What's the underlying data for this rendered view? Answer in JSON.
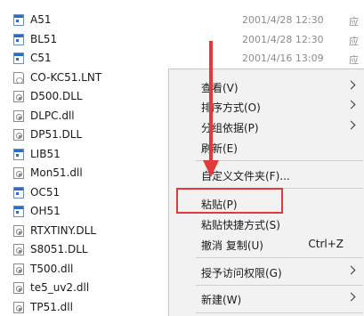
{
  "files": [
    {
      "name": "A51",
      "date": "2001/4/28 12:30",
      "type": "应",
      "icon": "app"
    },
    {
      "name": "BL51",
      "date": "2001/4/28 12:30",
      "type": "应",
      "icon": "app"
    },
    {
      "name": "C51",
      "date": "2001/4/16 13:09",
      "type": "应",
      "icon": "app"
    },
    {
      "name": "CO-KC51.LNT",
      "date": "",
      "type": "",
      "icon": "doc"
    },
    {
      "name": "D500.DLL",
      "date": "",
      "type": "",
      "icon": "dll"
    },
    {
      "name": "DLPC.dll",
      "date": "",
      "type": "",
      "icon": "dll"
    },
    {
      "name": "DP51.DLL",
      "date": "",
      "type": "",
      "icon": "dll"
    },
    {
      "name": "LIB51",
      "date": "",
      "type": "",
      "icon": "app"
    },
    {
      "name": "Mon51.dll",
      "date": "",
      "type": "",
      "icon": "dll"
    },
    {
      "name": "OC51",
      "date": "",
      "type": "",
      "icon": "app"
    },
    {
      "name": "OH51",
      "date": "",
      "type": "",
      "icon": "app"
    },
    {
      "name": "RTXTINY.DLL",
      "date": "",
      "type": "",
      "icon": "dll"
    },
    {
      "name": "S8051.DLL",
      "date": "",
      "type": "",
      "icon": "dll"
    },
    {
      "name": "T500.dll",
      "date": "",
      "type": "",
      "icon": "dll"
    },
    {
      "name": "te5_uv2.dll",
      "date": "",
      "type": "",
      "icon": "dll"
    },
    {
      "name": "TP51.dll",
      "date": "",
      "type": "",
      "icon": "dll"
    }
  ],
  "context_menu": {
    "items": [
      {
        "name": "view",
        "label": "查看(V)",
        "submenu": true
      },
      {
        "name": "sort-by",
        "label": "排序方式(O)",
        "submenu": true
      },
      {
        "name": "group-by",
        "label": "分组依据(P)",
        "submenu": true
      },
      {
        "name": "refresh",
        "label": "刷新(E)",
        "submenu": false
      },
      {
        "name": "customize-folder",
        "label": "自定义文件夹(F)...",
        "submenu": false
      },
      {
        "name": "paste",
        "label": "粘贴(P)",
        "submenu": false
      },
      {
        "name": "paste-shortcut",
        "label": "粘贴快捷方式(S)",
        "submenu": false
      },
      {
        "name": "undo-copy",
        "label": "撤消 复制(U)",
        "shortcut": "Ctrl+Z",
        "submenu": false
      },
      {
        "name": "give-access",
        "label": "授予访问权限(G)",
        "submenu": true
      },
      {
        "name": "new",
        "label": "新建(W)",
        "submenu": true
      }
    ]
  },
  "colors": {
    "highlight_border": "#e03a3a",
    "annotation_arrow": "#e03a3a",
    "menu_background": "#f2f2f2"
  }
}
